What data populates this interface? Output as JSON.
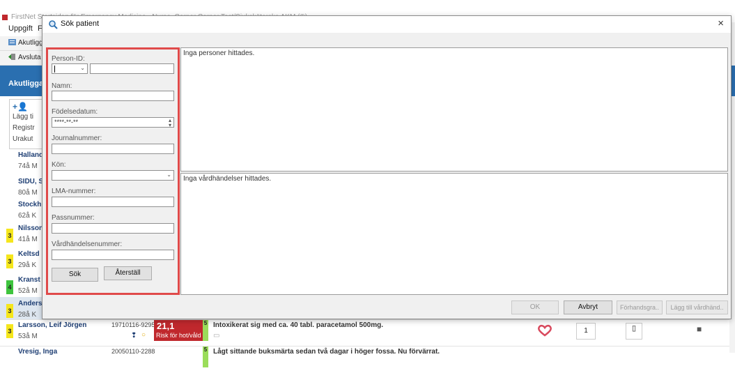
{
  "app": {
    "title": "FirstNet Startsidan för Emergency Medicine - Nurse, Cerner Cerner Test/Sjuksköterska AKM (®)",
    "menu": [
      "Uppgift",
      "F"
    ],
    "toolbar1_item": "Akutligg",
    "toolbar2_item": "Avsluta",
    "banner_label": "Akutligga",
    "add_panel": {
      "plus": "+👤",
      "lines": [
        "Lägg ti",
        "Registr",
        "Urakut"
      ]
    },
    "left_rows": [
      {
        "name": "Halland",
        "age": "74å M",
        "prio": "",
        "prio_color": ""
      },
      {
        "name": "SIDU, S",
        "age": "80å M",
        "prio": "",
        "prio_color": ""
      },
      {
        "name": "Stockh",
        "age": "62å K",
        "prio": "",
        "prio_color": ""
      },
      {
        "name": "Nilsson",
        "age": "41å M",
        "prio": "3",
        "prio_color": "#f5e61c"
      },
      {
        "name": "Keltsd",
        "age": "29å K",
        "prio": "3",
        "prio_color": "#f5e61c"
      },
      {
        "name": "Kranst",
        "age": "52å M",
        "prio": "4",
        "prio_color": "#3ec43e"
      },
      {
        "name": "Anders",
        "age": "28å K",
        "prio": "3",
        "prio_color": "#f5e61c"
      }
    ],
    "bottom_rows": [
      {
        "prio": "3",
        "name": "Larsson, Leif Jörgen",
        "age": "53å M",
        "pnr": "19710116-9295",
        "score": "21,1",
        "risk": "Risk för hot/våld",
        "level": "5",
        "reason": "Intoxikerat sig med ca. 40 tabl. paracetamol 500mg.",
        "count": "1"
      },
      {
        "prio": "",
        "name": "Vresig, Inga",
        "age": "",
        "pnr": "20050110-2288",
        "score": "",
        "risk": "",
        "level": "5",
        "reason": "Lågt sittande buksmärta sedan två dagar i höger fossa. Nu förvärrat.",
        "count": ""
      }
    ]
  },
  "dialog": {
    "title": "Sök patient",
    "close": "×",
    "form": {
      "person_id_label": "Person-ID:",
      "name_label": "Namn:",
      "dob_label": "Födelsedatum:",
      "dob_placeholder": "****-**-**",
      "journal_label": "Journalnummer:",
      "gender_label": "Kön:",
      "lma_label": "LMA-nummer:",
      "pass_label": "Passnummer:",
      "visit_label": "Vårdhändelsenummer:",
      "search_button": "Sök",
      "reset_button": "Återställ"
    },
    "results": {
      "persons_message": "Inga personer hittades.",
      "visits_message": "Inga vårdhändelser hittades."
    },
    "footer": {
      "ok": "OK",
      "cancel": "Avbryt",
      "preview": "Förhandsgra..",
      "add_visit": "Lägg till vårdhänd.."
    }
  },
  "colors": {
    "accent_blue": "#2a6fb0",
    "highlight_red": "#e04a4a",
    "risk_red": "#c0282d"
  }
}
